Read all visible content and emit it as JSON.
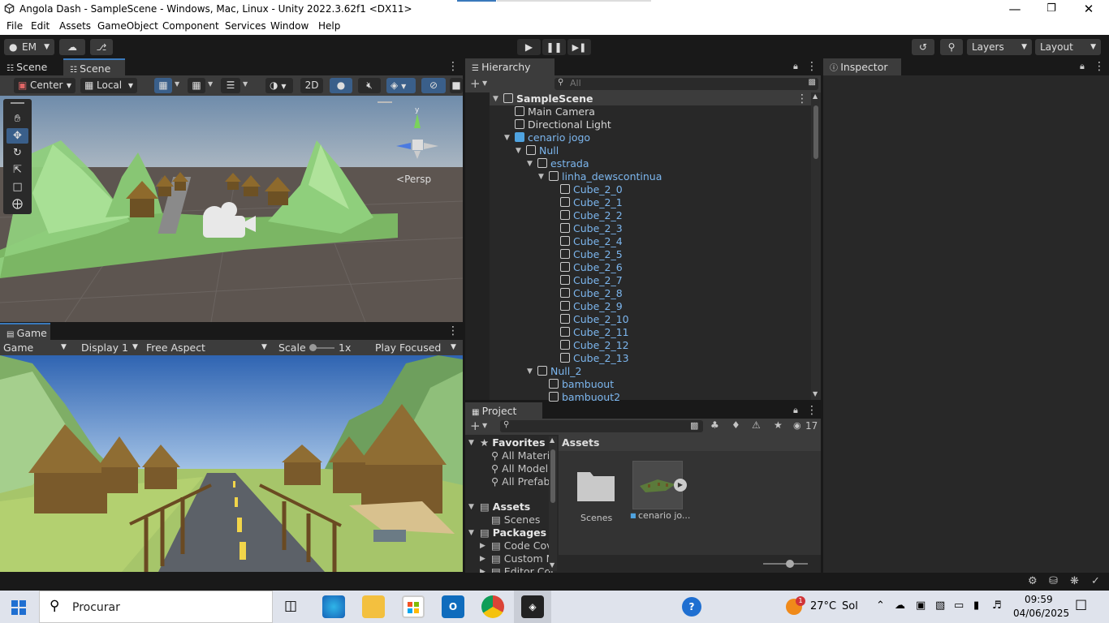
{
  "window": {
    "title": "Angola Dash - SampleScene - Windows, Mac, Linux - Unity 2022.3.62f1 <DX11>",
    "minimize": "—",
    "maximize": "❐",
    "close": "✕"
  },
  "menu": [
    "File",
    "Edit",
    "Assets",
    "GameObject",
    "Component",
    "Services",
    "Window",
    "Help"
  ],
  "toolbar": {
    "account": "EM",
    "layers": "Layers",
    "layout": "Layout"
  },
  "scene_panel": {
    "tabs": [
      "Scene",
      "Scene"
    ],
    "pivot": "Center",
    "space": "Local",
    "mode_2d": "2D",
    "persp": "Persp"
  },
  "game_panel": {
    "tab": "Game",
    "mode": "Game",
    "display": "Display 1",
    "aspect": "Free Aspect",
    "scale_label": "Scale",
    "scale_value": "1x",
    "play_mode": "Play Focused"
  },
  "hierarchy": {
    "title": "Hierarchy",
    "search_placeholder": "All",
    "items": [
      {
        "label": "SampleScene",
        "depth": 0,
        "arrow": "▼",
        "bold": true
      },
      {
        "label": "Main Camera",
        "depth": 1
      },
      {
        "label": "Directional Light",
        "depth": 1
      },
      {
        "label": "cenario jogo",
        "depth": 1,
        "arrow": "▼",
        "prefab": true
      },
      {
        "label": "Null",
        "depth": 2,
        "arrow": "▼",
        "prefab": true
      },
      {
        "label": "estrada",
        "depth": 3,
        "arrow": "▼",
        "prefab": true
      },
      {
        "label": "linha_dewscontinua",
        "depth": 4,
        "arrow": "▼",
        "prefab": true
      },
      {
        "label": "Cube_2_0",
        "depth": 5,
        "prefab": true
      },
      {
        "label": "Cube_2_1",
        "depth": 5,
        "prefab": true
      },
      {
        "label": "Cube_2_2",
        "depth": 5,
        "prefab": true
      },
      {
        "label": "Cube_2_3",
        "depth": 5,
        "prefab": true
      },
      {
        "label": "Cube_2_4",
        "depth": 5,
        "prefab": true
      },
      {
        "label": "Cube_2_5",
        "depth": 5,
        "prefab": true
      },
      {
        "label": "Cube_2_6",
        "depth": 5,
        "prefab": true
      },
      {
        "label": "Cube_2_7",
        "depth": 5,
        "prefab": true
      },
      {
        "label": "Cube_2_8",
        "depth": 5,
        "prefab": true
      },
      {
        "label": "Cube_2_9",
        "depth": 5,
        "prefab": true
      },
      {
        "label": "Cube_2_10",
        "depth": 5,
        "prefab": true
      },
      {
        "label": "Cube_2_11",
        "depth": 5,
        "prefab": true
      },
      {
        "label": "Cube_2_12",
        "depth": 5,
        "prefab": true
      },
      {
        "label": "Cube_2_13",
        "depth": 5,
        "prefab": true
      },
      {
        "label": "Null_2",
        "depth": 3,
        "arrow": "▼",
        "prefab": true
      },
      {
        "label": "bambuout",
        "depth": 4,
        "prefab": true
      },
      {
        "label": "bambuout2",
        "depth": 4,
        "prefab": true
      }
    ]
  },
  "project": {
    "title": "Project",
    "count": "17",
    "tree": [
      {
        "label": "Favorites",
        "arrow": "▼",
        "bold": true,
        "depth": 0,
        "kind": "star"
      },
      {
        "label": "All Materi",
        "depth": 1,
        "kind": "search"
      },
      {
        "label": "All Model",
        "depth": 1,
        "kind": "search"
      },
      {
        "label": "All Prefab",
        "depth": 1,
        "kind": "search"
      },
      {
        "label": "Assets",
        "arrow": "▼",
        "bold": true,
        "depth": 0,
        "kind": "folder",
        "gap": true
      },
      {
        "label": "Scenes",
        "depth": 1,
        "kind": "folder"
      },
      {
        "label": "Packages",
        "arrow": "▼",
        "bold": true,
        "depth": 0,
        "kind": "folder"
      },
      {
        "label": "Code Cov",
        "arrow": "▶",
        "depth": 1,
        "kind": "folder"
      },
      {
        "label": "Custom N",
        "arrow": "▶",
        "depth": 1,
        "kind": "folder"
      },
      {
        "label": "Editor Coi",
        "arrow": "▶",
        "depth": 1,
        "kind": "folder"
      }
    ],
    "breadcrumb": "Assets",
    "assets": [
      {
        "label": "Scenes"
      },
      {
        "label": "cenario jo..."
      }
    ]
  },
  "inspector": {
    "title": "Inspector"
  },
  "taskbar": {
    "search_placeholder": "Procurar",
    "weather_temp": "27°C",
    "weather_text": "Sol",
    "weather_badge": "1",
    "time": "09:59",
    "date": "04/06/2025"
  },
  "colors": {
    "accent": "#3a79bb",
    "prefab_text": "#7cb6ee",
    "panel_bg": "#282828",
    "toolbar_bg": "#191919"
  }
}
